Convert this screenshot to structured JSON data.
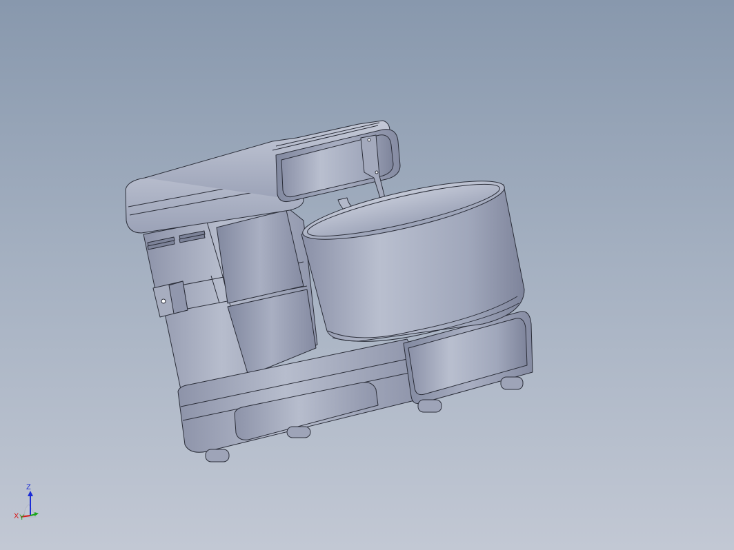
{
  "viewport": {
    "background_top": "#8898ad",
    "background_bottom": "#c2c8d4",
    "model": "stand-mixer-assembly"
  },
  "triad": {
    "axes": [
      {
        "label": "Z",
        "color": "#1a2bd6"
      },
      {
        "label": "X",
        "color": "#d61a1a"
      },
      {
        "label": "Y",
        "color": "#1aa61a"
      }
    ]
  },
  "colors": {
    "body_light": "#b4bacb",
    "body_mid": "#9aa1b6",
    "body_dark": "#7b8199",
    "edge": "#2a2d38"
  }
}
